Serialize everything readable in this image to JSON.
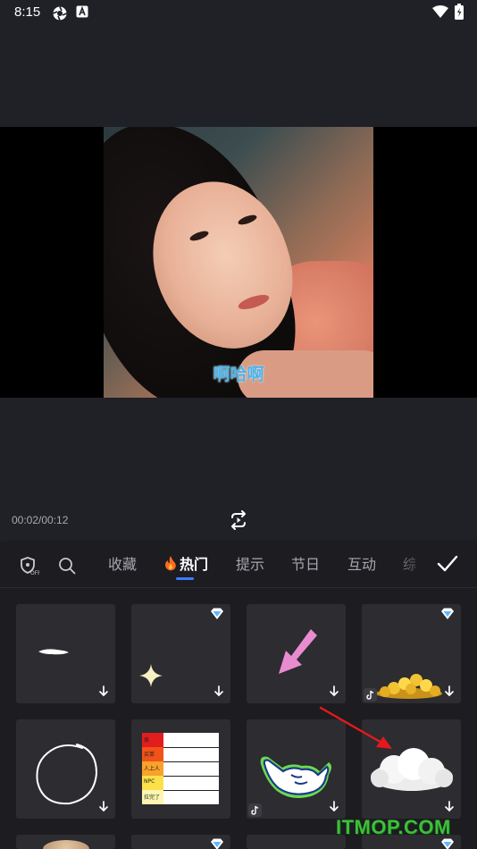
{
  "status_bar": {
    "time": "8:15"
  },
  "preview": {
    "caption": "啊哈啊"
  },
  "playback": {
    "time": "00:02/00:12"
  },
  "tabs": [
    {
      "label": "收藏"
    },
    {
      "label": "热门",
      "active": true
    },
    {
      "label": "提示"
    },
    {
      "label": "节日"
    },
    {
      "label": "互动"
    },
    {
      "label": "综"
    }
  ],
  "stickers": [
    {
      "name": "white stroke",
      "vip": false,
      "tiktok": false
    },
    {
      "name": "sparkle star",
      "vip": true,
      "tiktok": false
    },
    {
      "name": "pink arrow",
      "vip": false,
      "tiktok": false
    },
    {
      "name": "gold coins",
      "vip": true,
      "tiktok": true
    },
    {
      "name": "hand-drawn circle",
      "vip": false,
      "tiktok": false
    },
    {
      "name": "ranking list",
      "vip": false,
      "tiktok": false,
      "rows": [
        "卖",
        "买单",
        "人上人",
        "NPC",
        "拉完了"
      ]
    },
    {
      "name": "shaka hand",
      "vip": false,
      "tiktok": true
    },
    {
      "name": "cloud",
      "vip": false,
      "tiktok": false
    }
  ],
  "watermark": "ITMOP.COM",
  "colors": {
    "accent": "#3d7cff",
    "caption": "#4fb3e8",
    "watermark": "#3fbf3a",
    "annotation_arrow": "#e5191d"
  }
}
